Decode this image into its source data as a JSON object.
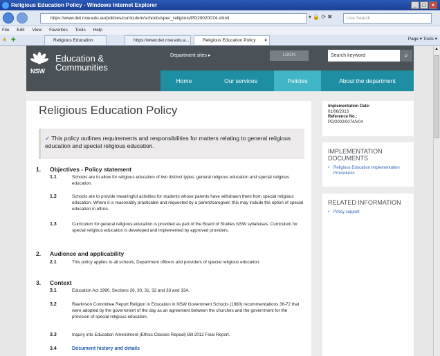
{
  "window": {
    "title": "Religious Education Policy - Windows Internet Explorer"
  },
  "browser": {
    "url": "https://www.det.nsw.edu.au/policies/curriculum/schools/spec_religious/PD20020074.shtml",
    "search_placeholder": "Live Search",
    "menu": [
      "File",
      "Edit",
      "View",
      "Favorites",
      "Tools",
      "Help"
    ],
    "tabs": [
      "Religious Education",
      "https://www.det.nsw.edu.a...",
      "Religious Education Policy"
    ],
    "tools": "Page ▾  Tools ▾"
  },
  "site": {
    "gov": "NSW",
    "brand_line1": "Education &",
    "brand_line2": "Communities",
    "dept_sites": "Department sites ▸",
    "login": "LOGIN",
    "search_placeholder": "Search keyword",
    "nav": [
      "Home",
      "Our services",
      "Policies",
      "About the department"
    ],
    "colors": {
      "header": "#4a5258",
      "nav": "#1e8fa3",
      "nav_active": "#3fb5c6"
    }
  },
  "page": {
    "title": "Religious Education Policy",
    "intro": "This policy outlines requirements and responsibilities for matters relating to general religious education and special religious education.",
    "sections": [
      {
        "num": "1.",
        "title": "Objectives - Policy statement",
        "items": [
          {
            "num": "1.1",
            "text": "Schools are to allow for religious education of two distinct types: general religious education and special religious education."
          },
          {
            "num": "1.2",
            "text": "Schools are to provide meaningful activities for students whose parents have withdrawn them from special religious education. Where it is reasonably practicable and requested by a parent/caregiver, this may include the option of special education in ethics."
          },
          {
            "num": "1.3",
            "text": "Curriculum for general religious education is provided as part of the Board of Studies NSW syllabuses. Curriculum for special religious education is developed and implemented by approved providers."
          }
        ]
      },
      {
        "num": "2.",
        "title": "Audience and applicability",
        "items": [
          {
            "num": "2.1",
            "text": "This policy applies to all schools, Department officers and providers of special religious education."
          }
        ]
      },
      {
        "num": "3.",
        "title": "Context",
        "items": [
          {
            "num": "3.1",
            "text": "Education Act 1990, Sections 26, 30, 31, 32 and 33 and 33A."
          },
          {
            "num": "3.2",
            "text": "Rawlinson Committee Report Religion in Education in NSW Government Schools (1980) recommendations 36-72 that were adopted by the government of the day as an agreement between the churches and the government for the provision of special religious education."
          },
          {
            "num": "3.3",
            "text": "Inquiry into Education Amendment (Ethics Classes Repeal) Bill 2012 Final Report."
          },
          {
            "num": "3.4",
            "text": "Document history and details"
          }
        ]
      }
    ]
  },
  "sidebar": {
    "impl_date_label": "Implementation Date:",
    "impl_date": "01/06/2013",
    "ref_label": "Reference No.:",
    "ref": "PD/2002/0074/V04",
    "impl_docs_title": "IMPLEMENTATION DOCUMENTS",
    "impl_docs_link": "Religious Education Implementation Procedures",
    "related_title": "RELATED INFORMATION",
    "related_link": "Policy support"
  }
}
